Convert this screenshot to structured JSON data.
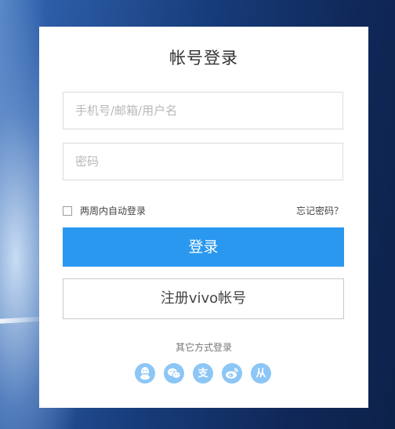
{
  "login": {
    "title": "帐号登录",
    "username": {
      "placeholder": "手机号/邮箱/用户名",
      "value": ""
    },
    "password": {
      "placeholder": "密码",
      "value": ""
    },
    "remember_label": "两周内自动登录",
    "forgot_label": "忘记密码？",
    "login_button": "登录",
    "register_button": "注册vivo帐号",
    "other_methods_label": "其它方式登录",
    "social": [
      {
        "icon": "qq-icon",
        "glyph": ""
      },
      {
        "icon": "wechat-icon",
        "glyph": ""
      },
      {
        "icon": "alipay-icon",
        "glyph": "支"
      },
      {
        "icon": "weibo-icon",
        "glyph": ""
      },
      {
        "icon": "renren-icon",
        "glyph": "从"
      }
    ]
  },
  "colors": {
    "primary": "#2b98f0",
    "social": "#8cc6f6",
    "card": "#ffffff"
  }
}
